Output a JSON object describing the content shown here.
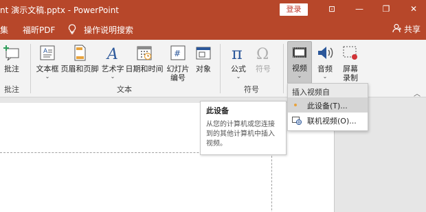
{
  "titlebar": {
    "title": "nt 演示文稿.pptx  -  PowerPoint",
    "login_label": "登录",
    "controls": {
      "ribbon_display": "⊡",
      "minimize": "—",
      "restore": "❐",
      "close": "✕"
    }
  },
  "tabs": {
    "items": [
      "集",
      "福昕PDF"
    ],
    "tell_me": "操作说明搜索",
    "share": "共享"
  },
  "ribbon": {
    "groups": {
      "comments": {
        "label": "批注",
        "buttons": {
          "comment": "批注"
        }
      },
      "text": {
        "label": "文本",
        "buttons": {
          "textbox": "文本框",
          "header_footer": "页眉和页脚",
          "wordart": "艺术字",
          "datetime": "日期和时间",
          "slide_number_1": "幻灯片",
          "slide_number_2": "编号",
          "object": "对象"
        }
      },
      "symbols": {
        "label": "符号",
        "buttons": {
          "equation": "公式",
          "symbol": "符号"
        }
      },
      "media": {
        "buttons": {
          "video": "视频",
          "audio": "音频",
          "screen_record_1": "屏幕",
          "screen_record_2": "录制"
        }
      }
    },
    "caret": "⌄",
    "collapse": "︿"
  },
  "dropdown": {
    "header": "插入视频自",
    "items": [
      "此设备(T)...",
      "联机视频(O)..."
    ]
  },
  "tooltip": {
    "title": "此设备",
    "body": "从您的计算机或您连接到的其他计算机中插入视频。"
  },
  "colors": {
    "accent": "#b7472a",
    "ribbon_bg": "#f3f3f3",
    "workspace_bg": "#e6e6e6"
  }
}
